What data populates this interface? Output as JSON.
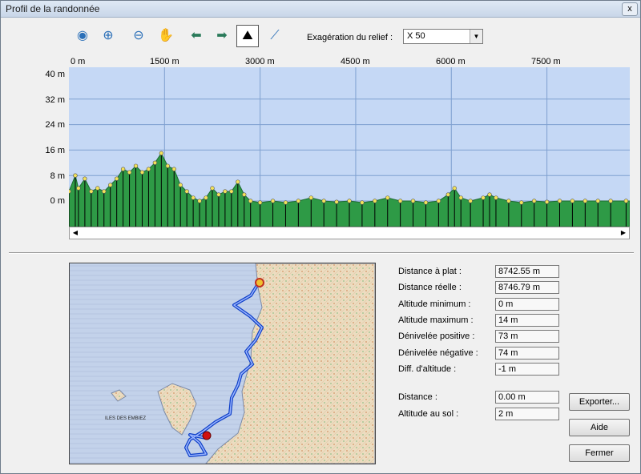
{
  "window": {
    "title": "Profil de la randonnée",
    "close_glyph": "x"
  },
  "toolbar": {
    "tools": [
      {
        "name": "globe-zoom-icon",
        "glyph": "◉"
      },
      {
        "name": "zoom-in-icon",
        "glyph": "⊕"
      },
      {
        "name": "zoom-out-icon",
        "glyph": "⊖"
      },
      {
        "name": "pan-hand-icon",
        "glyph": "✋"
      },
      {
        "name": "arrow-left-icon",
        "glyph": "⬅"
      },
      {
        "name": "arrow-right-icon",
        "glyph": "➡"
      },
      {
        "name": "relief-profile-icon",
        "glyph": "⛰"
      },
      {
        "name": "altitude-zoom-icon",
        "glyph": "⟋"
      }
    ],
    "exaggeration_label": "Exagération du relief :",
    "exaggeration_value": "X 50"
  },
  "chart_data": {
    "type": "area",
    "x_ticks": [
      "0 m",
      "1500 m",
      "3000 m",
      "4500 m",
      "6000 m",
      "7500 m"
    ],
    "y_ticks": [
      "40 m",
      "32 m",
      "24 m",
      "16 m",
      "8 m",
      "0 m"
    ],
    "xlim": [
      0,
      8742.55
    ],
    "ylim": [
      -4,
      40
    ],
    "grid": true,
    "colors": {
      "background": "#c5d8f5",
      "fill": "#2e9a46",
      "grid": "#7fa0d0",
      "marker": "#f3e25a"
    },
    "profile": [
      [
        0,
        3
      ],
      [
        100,
        8
      ],
      [
        150,
        4
      ],
      [
        250,
        7
      ],
      [
        350,
        3
      ],
      [
        450,
        4
      ],
      [
        550,
        3
      ],
      [
        650,
        5
      ],
      [
        750,
        7
      ],
      [
        850,
        10
      ],
      [
        950,
        9
      ],
      [
        1050,
        11
      ],
      [
        1150,
        9
      ],
      [
        1250,
        10
      ],
      [
        1350,
        12
      ],
      [
        1450,
        15
      ],
      [
        1550,
        11
      ],
      [
        1650,
        10
      ],
      [
        1750,
        5
      ],
      [
        1850,
        3
      ],
      [
        1950,
        1
      ],
      [
        2050,
        0
      ],
      [
        2150,
        1
      ],
      [
        2250,
        4
      ],
      [
        2350,
        2
      ],
      [
        2450,
        3
      ],
      [
        2550,
        3
      ],
      [
        2650,
        6
      ],
      [
        2750,
        2
      ],
      [
        2850,
        0
      ],
      [
        3000,
        -0.5
      ],
      [
        3200,
        0
      ],
      [
        3400,
        -0.5
      ],
      [
        3600,
        0
      ],
      [
        3800,
        1
      ],
      [
        4000,
        0
      ],
      [
        4200,
        -0.3
      ],
      [
        4400,
        0
      ],
      [
        4600,
        -0.5
      ],
      [
        4800,
        0
      ],
      [
        5000,
        1
      ],
      [
        5200,
        0
      ],
      [
        5400,
        0
      ],
      [
        5600,
        -0.5
      ],
      [
        5800,
        0
      ],
      [
        5950,
        2
      ],
      [
        6050,
        4
      ],
      [
        6150,
        1
      ],
      [
        6300,
        0
      ],
      [
        6500,
        1
      ],
      [
        6600,
        2
      ],
      [
        6700,
        1
      ],
      [
        6900,
        0
      ],
      [
        7100,
        -0.5
      ],
      [
        7300,
        0
      ],
      [
        7500,
        -0.3
      ],
      [
        7700,
        0
      ],
      [
        7900,
        0
      ],
      [
        8100,
        0
      ],
      [
        8300,
        0
      ],
      [
        8500,
        0
      ],
      [
        8742,
        0
      ]
    ]
  },
  "map": {
    "labels": [
      "ILES DES EMBIEZ"
    ]
  },
  "stats": [
    {
      "label": "Distance à plat :",
      "value": "8742.55 m"
    },
    {
      "label": "Distance réelle :",
      "value": "8746.79 m"
    },
    {
      "label": "Altitude minimum :",
      "value": "0 m"
    },
    {
      "label": "Altitude maximum :",
      "value": "14 m"
    },
    {
      "label": "Dénivelée positive :",
      "value": "73 m"
    },
    {
      "label": "Dénivelée négative :",
      "value": "74 m"
    },
    {
      "label": "Diff. d'altitude :",
      "value": "-1 m"
    }
  ],
  "cursor": [
    {
      "label": "Distance :",
      "value": "0.00 m"
    },
    {
      "label": "Altitude au sol :",
      "value": "2 m"
    }
  ],
  "buttons": {
    "export": "Exporter...",
    "help": "Aide",
    "close": "Fermer"
  }
}
